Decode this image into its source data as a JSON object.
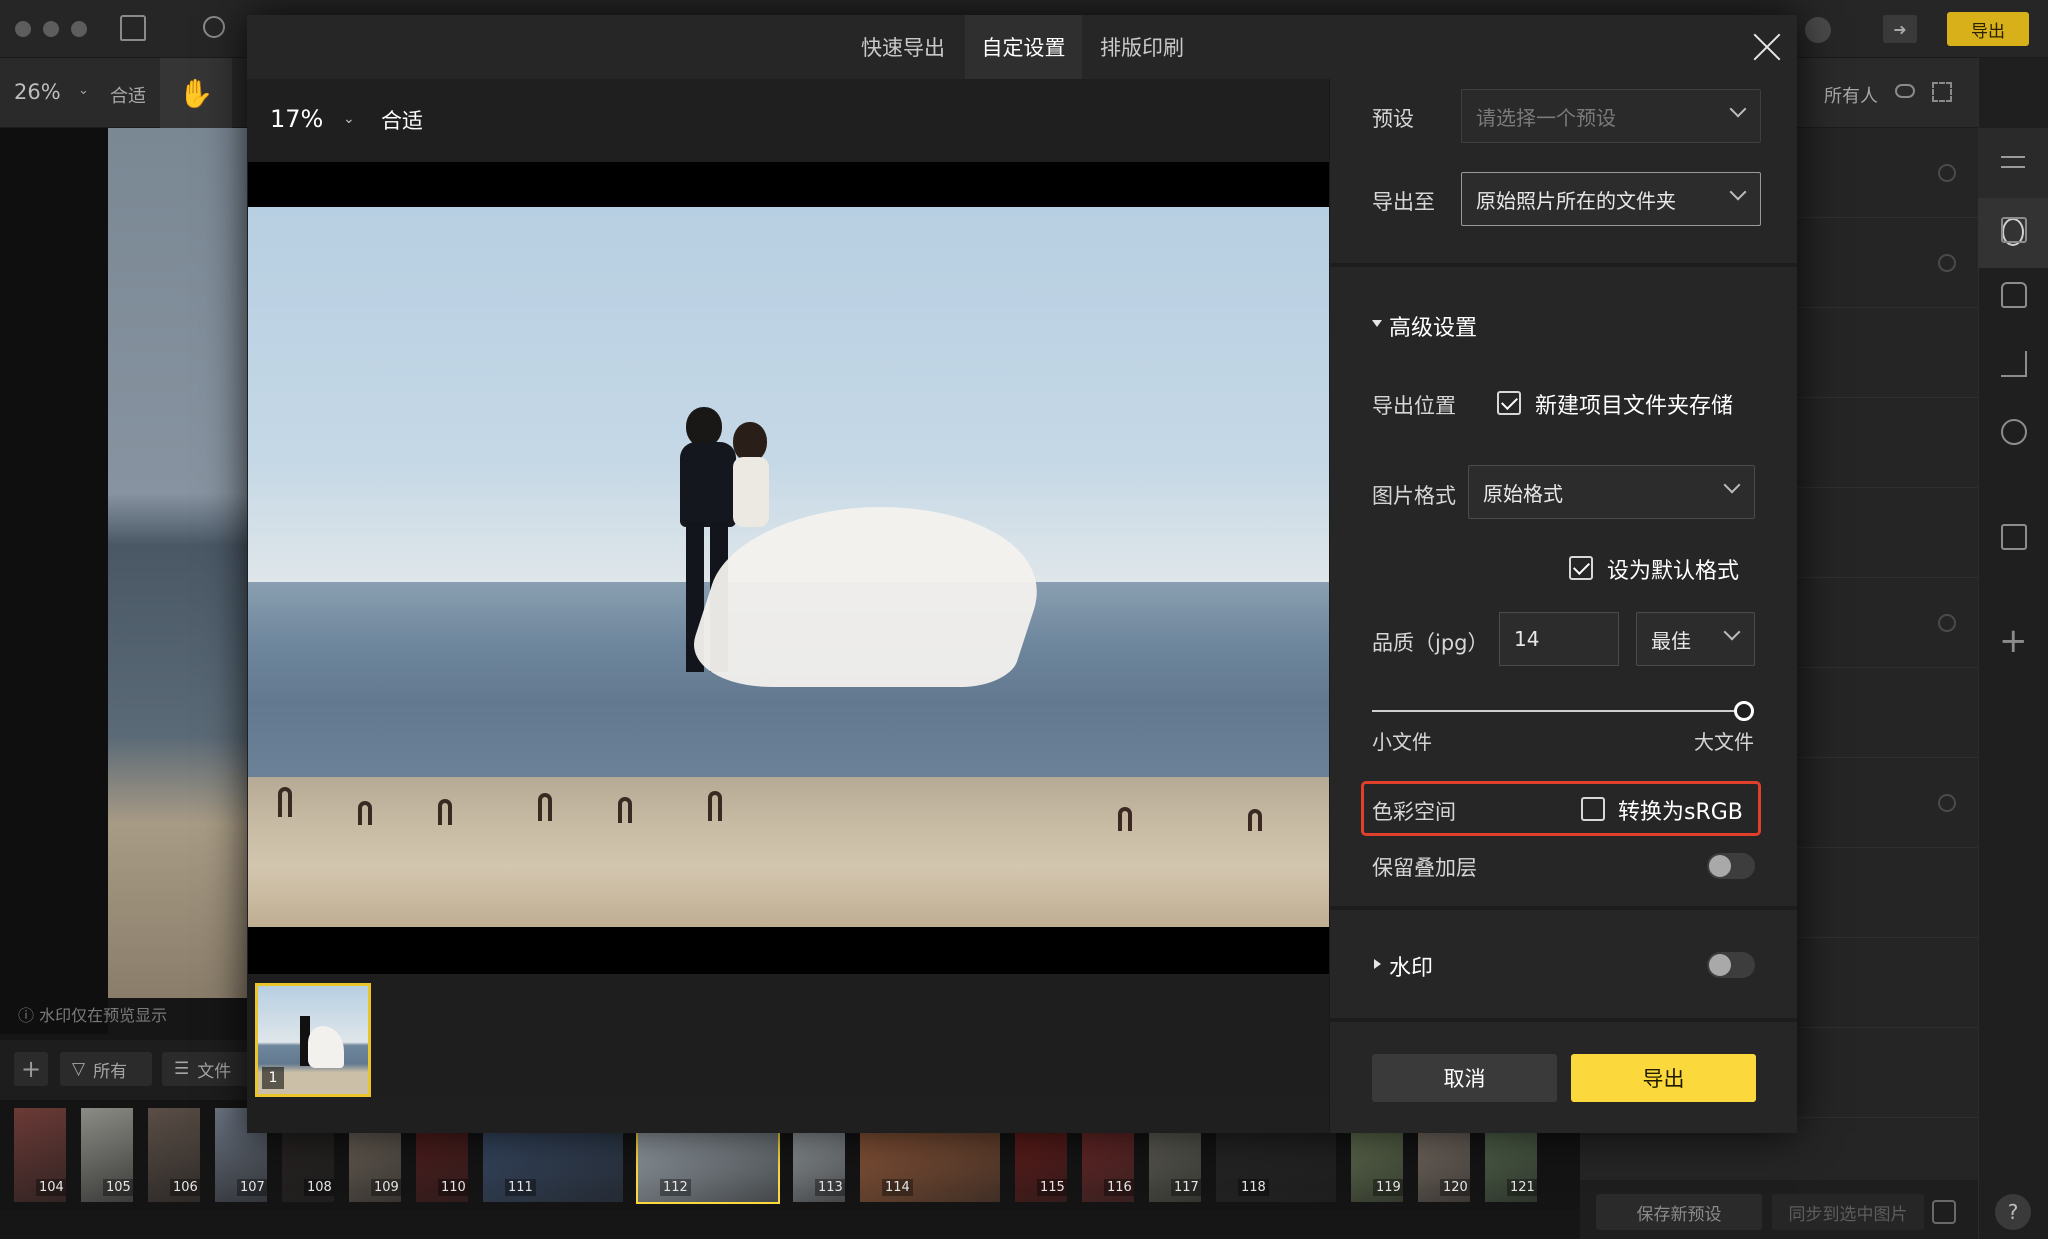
{
  "app": {
    "zoom": "26%",
    "fit_label": "合适",
    "export_label": "导出",
    "owner_label": "所有人",
    "watermark_note": "水印仅在预览显示",
    "filter_all": "所有",
    "filter_file": "文件",
    "save_preset": "保存新预设",
    "sync_selected": "同步到选中图片",
    "help": "?"
  },
  "filmstrip": [
    {
      "num": "104",
      "color": "#6b3a36"
    },
    {
      "num": "105",
      "color": "#8c8c86"
    },
    {
      "num": "106",
      "color": "#5a4e46"
    },
    {
      "num": "107",
      "color": "#6c7583"
    },
    {
      "num": "108",
      "color": "#2a2424"
    },
    {
      "num": "109",
      "color": "#7a6f63"
    },
    {
      "num": "110",
      "color": "#5d1e1e"
    },
    {
      "num": "111",
      "color": "#3b4f6d"
    },
    {
      "num": "112",
      "color": "#a9b4bd"
    },
    {
      "num": "113",
      "color": "#aab2b7"
    },
    {
      "num": "114",
      "color": "#9b5e3d"
    },
    {
      "num": "115",
      "color": "#6e1c1a"
    },
    {
      "num": "116",
      "color": "#7a2a2a"
    },
    {
      "num": "117",
      "color": "#6d6d62"
    },
    {
      "num": "118",
      "color": "#262626"
    },
    {
      "num": "119",
      "color": "#6e7f5a"
    },
    {
      "num": "120",
      "color": "#8a7d72"
    },
    {
      "num": "121",
      "color": "#5d7356"
    }
  ],
  "modal": {
    "tabs": [
      "快速导出",
      "自定设置",
      "排版印刷"
    ],
    "active_tab": "自定设置",
    "preview": {
      "zoom": "17%",
      "fit_label": "合适",
      "thumb_index": "1"
    },
    "settings": {
      "preset_label": "预设",
      "preset_placeholder": "请选择一个预设",
      "export_to_label": "导出至",
      "export_to_value": "原始照片所在的文件夹",
      "advanced_title": "高级设置",
      "export_location_label": "导出位置",
      "new_folder_label": "新建项目文件夹存储",
      "new_folder_checked": true,
      "format_label": "图片格式",
      "format_value": "原始格式",
      "default_format_label": "设为默认格式",
      "default_format_checked": true,
      "quality_label": "品质（jpg）",
      "quality_value": "14",
      "quality_level": "最佳",
      "quality_slider_fraction": 1.0,
      "small_file": "小文件",
      "large_file": "大文件",
      "color_space_label": "色彩空间",
      "srgb_label": "转换为sRGB",
      "srgb_checked": false,
      "keep_overlay_label": "保留叠加层",
      "keep_overlay_on": false,
      "watermark_label": "水印",
      "watermark_on": false,
      "cancel": "取消",
      "export": "导出"
    }
  },
  "colors": {
    "accent_yellow": "#fbd93c",
    "highlight_red": "#e0402b"
  }
}
